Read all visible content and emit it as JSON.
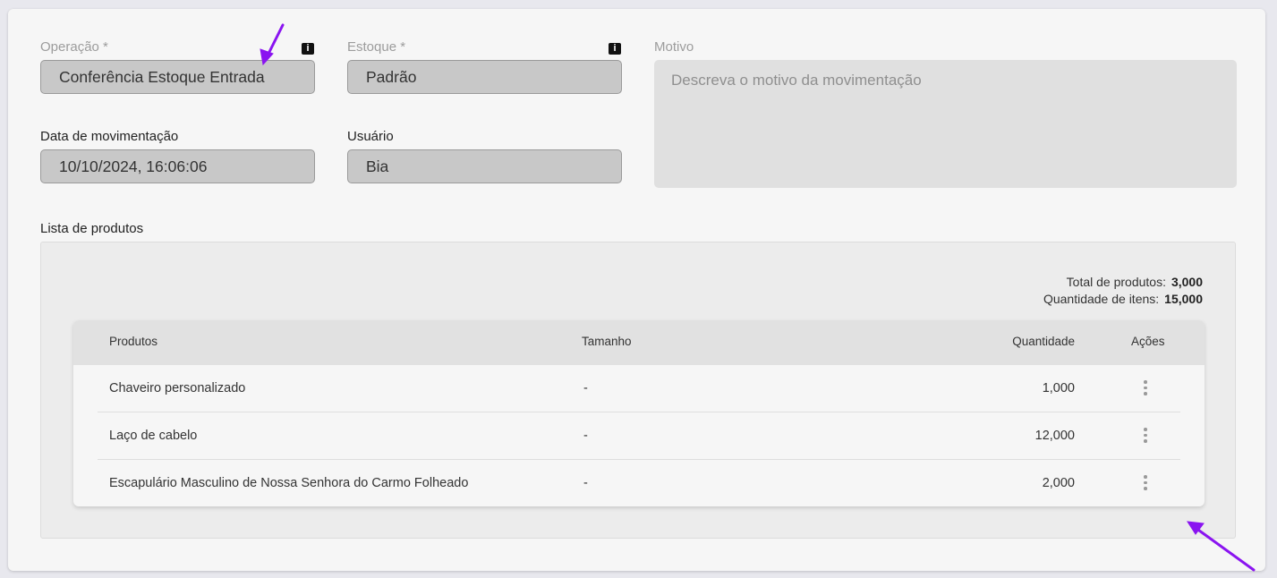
{
  "form": {
    "operacao": {
      "label": "Operação *",
      "value": "Conferência Estoque Entrada"
    },
    "estoque": {
      "label": "Estoque *",
      "value": "Padrão"
    },
    "motivo": {
      "label": "Motivo",
      "placeholder": "Descreva o motivo da movimentação"
    },
    "data": {
      "label": "Data de movimentação",
      "value": "10/10/2024, 16:06:06"
    },
    "usuario": {
      "label": "Usuário",
      "value": "Bia"
    }
  },
  "info_icon_glyph": "i",
  "products": {
    "title": "Lista de produtos",
    "totals": {
      "total_label": "Total de produtos:",
      "total_value": "3,000",
      "items_label": "Quantidade de itens:",
      "items_value": "15,000"
    },
    "columns": [
      "Produtos",
      "Tamanho",
      "Quantidade",
      "Ações"
    ],
    "rows": [
      {
        "produto": "Chaveiro personalizado",
        "tamanho": "-",
        "quantidade": "1,000"
      },
      {
        "produto": "Laço de cabelo",
        "tamanho": "-",
        "quantidade": "12,000"
      },
      {
        "produto": "Escapulário Masculino de Nossa Senhora do Carmo Folheado",
        "tamanho": "-",
        "quantidade": "2,000"
      }
    ]
  },
  "icons": [
    "info-icon",
    "more-vertical-icon",
    "annotation-arrow"
  ],
  "colors": {
    "annotation_arrow": "#8a14f0",
    "field_bg": "#c8c8c8"
  }
}
